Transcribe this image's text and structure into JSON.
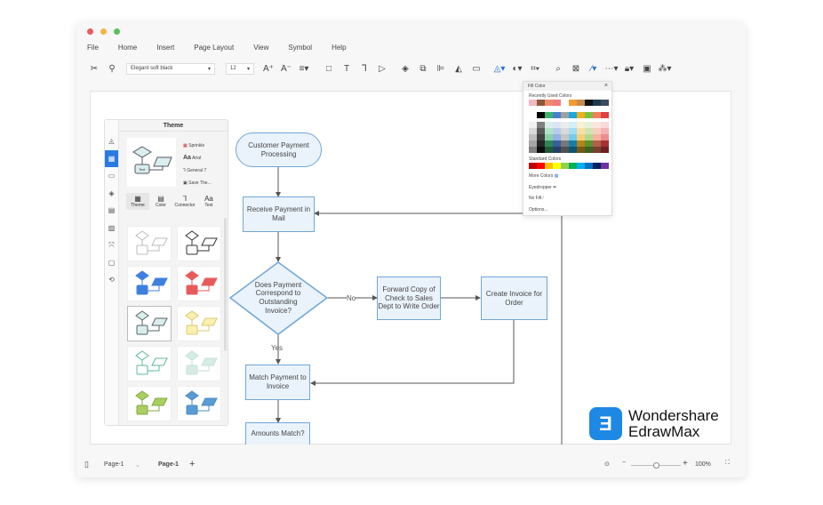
{
  "menu": [
    "File",
    "Home",
    "Insert",
    "Page Layout",
    "View",
    "Symbol",
    "Help"
  ],
  "toolbar": {
    "font": "Elegant soft black",
    "size": "12"
  },
  "theme_panel": {
    "title": "Theme",
    "options": [
      "Sprinkle",
      "Arial",
      "General 7",
      "Save The..."
    ],
    "tabs": [
      "Theme",
      "Color",
      "Connector",
      "Text"
    ],
    "preview_label": "Text",
    "themes": [
      {
        "fill": "#ffffff",
        "stroke": "#bbbbbb"
      },
      {
        "fill": "#ffffff",
        "stroke": "#333333"
      },
      {
        "fill": "#3f7fe0",
        "stroke": "#3f7fe0"
      },
      {
        "fill": "#e85a5a",
        "stroke": "#e85a5a"
      },
      {
        "fill": "#d9eeee",
        "stroke": "#556666"
      },
      {
        "fill": "#fbf0b0",
        "stroke": "#d8c870"
      },
      {
        "fill": "#ffffff",
        "stroke": "#5bb8a0"
      },
      {
        "fill": "#d5ece6",
        "stroke": "#c5e0d8"
      },
      {
        "fill": "#a8d060",
        "stroke": "#80a840"
      },
      {
        "fill": "#5b9bd5",
        "stroke": "#4a88c0"
      }
    ]
  },
  "fill_color": {
    "title": "Fill Color",
    "recent_label": "Recently Used Colors",
    "recent": [
      "#f4b6c2",
      "#8b5a3c",
      "#f08a6c",
      "#f07b7b",
      "",
      "#f39c32",
      "#c68a4e",
      "#111111",
      "#1e3a4f",
      "#3d4a5c"
    ],
    "theme_colors": [
      "#ffffff",
      "#000000",
      "#3cb371",
      "#4a7fd0",
      "#a0a0a0",
      "#1aa8e0",
      "#f0b020",
      "#7cc040",
      "#f08060",
      "#e04040"
    ],
    "standard_label": "Standard Colors",
    "standard": [
      "#c00000",
      "#ff0000",
      "#ffc000",
      "#ffff00",
      "#92d050",
      "#00b050",
      "#00b0f0",
      "#0070c0",
      "#002060",
      "#7030a0"
    ],
    "more": "More Colors",
    "eyedropper": "Eyedropper",
    "nofill": "No Fill",
    "options": "Options..."
  },
  "flow": {
    "start": "Customer Payment Processing",
    "receive": "Receive Payment in Mail",
    "decision": "Does Payment Correspond to Outstanding Invoice?",
    "no": "No",
    "yes": "Yes",
    "forward": "Forward Copy of Check to Sales Dept to Write Order",
    "create": "Create Invoice for Order",
    "match": "Match Payment to Invoice",
    "amounts": "Amounts Match?"
  },
  "logo": {
    "line1": "Wondershare",
    "line2": "EdrawMax"
  },
  "status": {
    "page_select": "Page-1",
    "page_tab": "Page-1",
    "zoom": "100%",
    "zoom_level": 0.5
  }
}
